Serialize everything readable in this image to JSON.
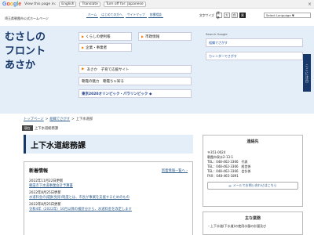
{
  "translate_bar": {
    "logo": [
      "G",
      "o",
      "o",
      "g",
      "l",
      "e"
    ],
    "view_text": "View this page in:",
    "language": "English",
    "translate_label": "Translate",
    "turn_off_text": "Turn off for: Japanese",
    "close": "×"
  },
  "header": {
    "site_title": "埼玉県朝霞市公式ホームページ",
    "nav": [
      "ホーム",
      "はじめての方へ",
      "サイトマップ",
      "各種相談"
    ],
    "text_size_label": "文字サイズ",
    "sizes": [
      "標準",
      "大",
      "色",
      "黒"
    ],
    "lang_select": "Select Language ▼"
  },
  "hero": {
    "logo_lines": [
      "むさしの",
      "フロント",
      "あさか"
    ],
    "menu_left": [
      "くらしの便利帳",
      "企業・事業者"
    ],
    "menu_right": [
      "市政情報"
    ],
    "child_support": "あさか　子育て応援サイト",
    "asaka_text": "朝霞の魅力　朝霞ちゃ知る",
    "olympic": "東京2020オリンピック・パラリンピック ◆",
    "search_label": "Search Google",
    "field1": "組織でさがす",
    "field2": "カレンダーでさがす",
    "side_tab": [
      "こ",
      "こ",
      "に",
      "注",
      "目"
    ]
  },
  "breadcrumb": {
    "items": [
      "トップページ",
      "組織でさがす",
      "上下水道部"
    ],
    "sep": ">",
    "chip": "現在",
    "chip_text": "上下水道総務課"
  },
  "page_title": "上下水道総務課",
  "news": {
    "title": "新着情報",
    "more": "新着情報一覧へ ›",
    "items": [
      {
        "date": "2022年11月22日更新",
        "link": "朝霞市下水道事業会計予算書"
      },
      {
        "date": "2022年8月25日更新",
        "link": "水道料金の減額(免除)制度とは、市長が事業を支援するためのもの"
      },
      {
        "date": "2022年8月25日更新",
        "link": "令和4年（2022年）10月以降の検針分から、水道料金を改定します"
      }
    ]
  },
  "contact": {
    "title": "連絡先",
    "lines": [
      "〒351-0024",
      "朝霞市泉水2-13-1",
      "TEL：048-462-3366　代表",
      "TEL：048-462-3366　経営係",
      "TEL：048-462-3366　会計係",
      "FAX：048-465-1891"
    ],
    "mail_button": "メールでお問い合わせはこちら"
  },
  "business": {
    "title": "主な業務",
    "line": "・上下水道(下水道)の使用水量の計量及び"
  }
}
